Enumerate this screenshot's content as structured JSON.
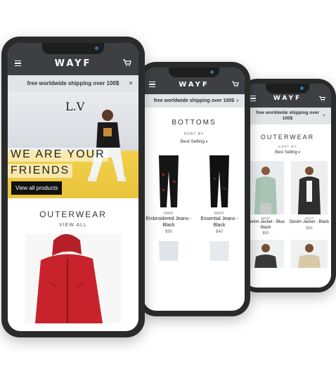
{
  "app": {
    "logo": "WAYF",
    "menu_icon": "hamburger-icon",
    "cart_icon": "cart-icon"
  },
  "shipping_banner": {
    "text": "free worldwide shipping over 100$",
    "close": "×"
  },
  "phone_home": {
    "hero_tag": "L.V",
    "headline_line1": "WE ARE YOUR",
    "headline_line2": "FRIENDS",
    "cta": "View all products",
    "section_title": "OUTERWEAR",
    "section_link": "VIEW ALL"
  },
  "phone_bottoms": {
    "collection_title": "BOTTOMS",
    "sort_label": "SORT BY",
    "sort_value": "Best Selling",
    "products": [
      {
        "vendor": "WAYF",
        "name": "Embroidered Jeans - Black",
        "price": "$50"
      },
      {
        "vendor": "WAYF",
        "name": "Essential Jeans - Black",
        "price": "$40"
      }
    ]
  },
  "phone_outerwear": {
    "collection_title": "OUTERWEAR",
    "sort_label": "SORT BY",
    "sort_value": "Best Selling",
    "products": [
      {
        "vendor": "WAYF",
        "name": "Denim Jacket - Blue Wash",
        "price": "$50"
      },
      {
        "vendor": "WAYF",
        "name": "Denim Jacket - Black",
        "price": "$50"
      }
    ]
  },
  "colors": {
    "header": "#3d3f42",
    "banner": "#e2e4e6",
    "hero_yellow": "#f2d04a",
    "hoodie_red": "#c8232c"
  }
}
